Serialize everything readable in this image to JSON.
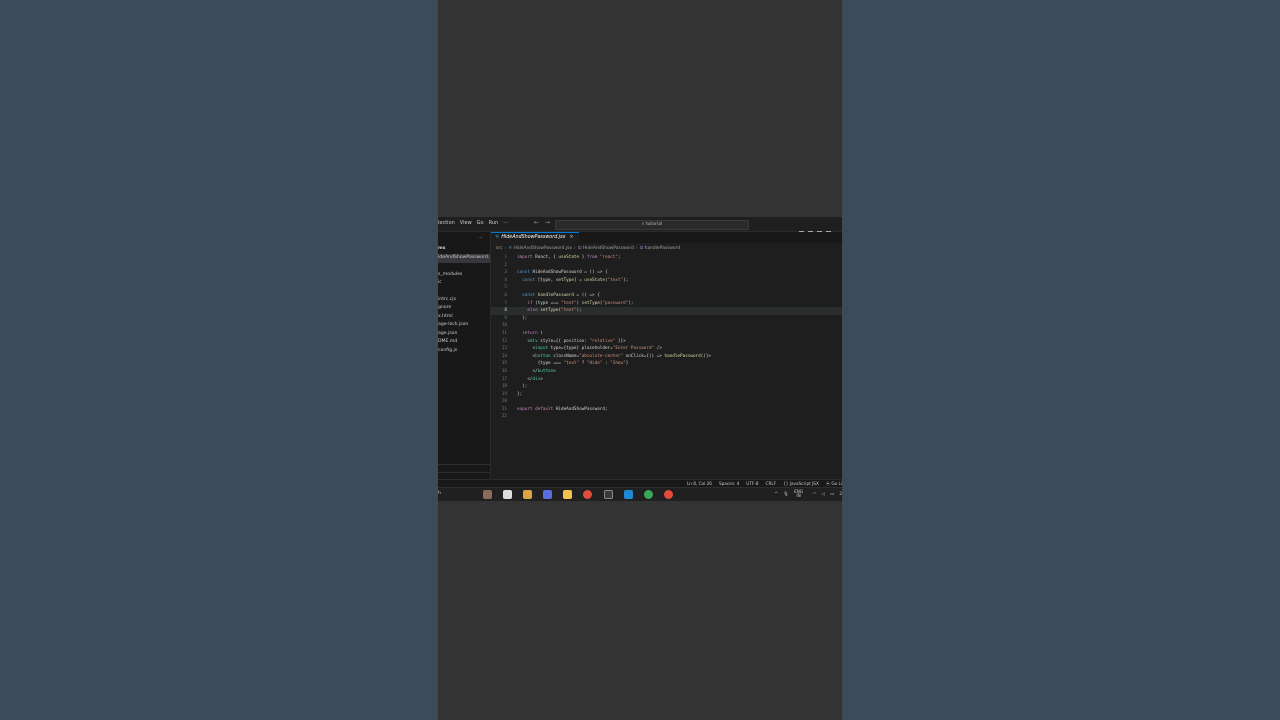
{
  "menu": [
    "lection",
    "View",
    "Go",
    "Run",
    "···"
  ],
  "nav": {
    "back": "←",
    "forward": "→"
  },
  "search": {
    "label": "⌕ tutorial"
  },
  "explorer": {
    "header": "ms",
    "items": [
      "ideAndShowPassword...",
      "s_modules",
      "ic",
      "intrc.cjs",
      "gnore",
      "x.html",
      "age-lock.json",
      "age.json",
      "DME.md",
      "config.js"
    ]
  },
  "tab": {
    "icon": "jsx",
    "label": "HideAndShowPassword.jsx",
    "close": "×"
  },
  "breadcrumb": {
    "folder": "src",
    "file_icon": "⚛",
    "file": "HideAndShowPassword.jsx",
    "component": "HideAndShowPassword",
    "fn": "handlePassword"
  },
  "code_lines": [
    {
      "n": "1",
      "text": "import React, { useState } from \"react\";"
    },
    {
      "n": "2",
      "text": ""
    },
    {
      "n": "3",
      "text": "const HideAndShowPassword = () => {"
    },
    {
      "n": "4",
      "text": "  const [type, setType] = useState(\"text\");"
    },
    {
      "n": "5",
      "text": ""
    },
    {
      "n": "6",
      "text": "  const handlePassword = () => {"
    },
    {
      "n": "7",
      "text": "    if (type === \"text\") setType(\"password\");"
    },
    {
      "n": "8",
      "text": "    else setType(\"text\");"
    },
    {
      "n": "9",
      "text": "  };"
    },
    {
      "n": "10",
      "text": ""
    },
    {
      "n": "11",
      "text": "  return ("
    },
    {
      "n": "12",
      "text": "    <div style={{ position: \"relative\" }}>"
    },
    {
      "n": "13",
      "text": "      <input type={type} placeholder=\"Enter Password\" />"
    },
    {
      "n": "14",
      "text": "      <button className=\"absolute-center\" onClick={() => handlePassword()}>"
    },
    {
      "n": "15",
      "text": "        {type === \"text\" ? \"Hide\" : \"Show\"}"
    },
    {
      "n": "16",
      "text": "      </button>"
    },
    {
      "n": "17",
      "text": "    </div>"
    },
    {
      "n": "18",
      "text": "  );"
    },
    {
      "n": "19",
      "text": "};"
    },
    {
      "n": "20",
      "text": ""
    },
    {
      "n": "21",
      "text": "export default HideAndShowPassword;"
    },
    {
      "n": "22",
      "text": ""
    }
  ],
  "current_line": "8",
  "status": {
    "position": "Ln 8, Col 26",
    "spaces": "Spaces: 4",
    "encoding": "UTF-8",
    "eol": "CRLF",
    "language": "{} JavaScript JSX",
    "golive": "⦿ Go Li"
  },
  "taskbar": {
    "search": "h",
    "lang_top": "ENG",
    "lang_bottom": "IN",
    "time": "2"
  },
  "colors": {
    "accent": "#0078d4",
    "editor_bg": "#1e1e1e",
    "side_bg": "#3c4b59"
  }
}
